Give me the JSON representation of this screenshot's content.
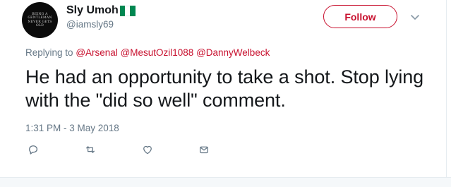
{
  "user": {
    "name": "Sly Umoh",
    "handle": "@iamsly69",
    "avatar_text": [
      "BEING A",
      "GENTLEMAN",
      "NEVER GETS",
      "OLD"
    ],
    "flag_colors": [
      "#008751",
      "#ffffff",
      "#008751"
    ]
  },
  "follow_button": {
    "label": "Follow"
  },
  "reply": {
    "prefix": "Replying to",
    "mentions": [
      "@Arsenal",
      "@MesutOzil1088",
      "@DannyWelbeck"
    ]
  },
  "tweet": {
    "text": "He had an opportunity to take a shot. Stop lying with the \"did so well\" comment.",
    "timestamp": "1:31 PM - 3 May 2018"
  },
  "actions": [
    "reply-icon",
    "retweet-icon",
    "like-icon",
    "direct-message-icon"
  ],
  "colors": {
    "accent": "#c8102e",
    "muted": "#657786",
    "text": "#14171a"
  }
}
